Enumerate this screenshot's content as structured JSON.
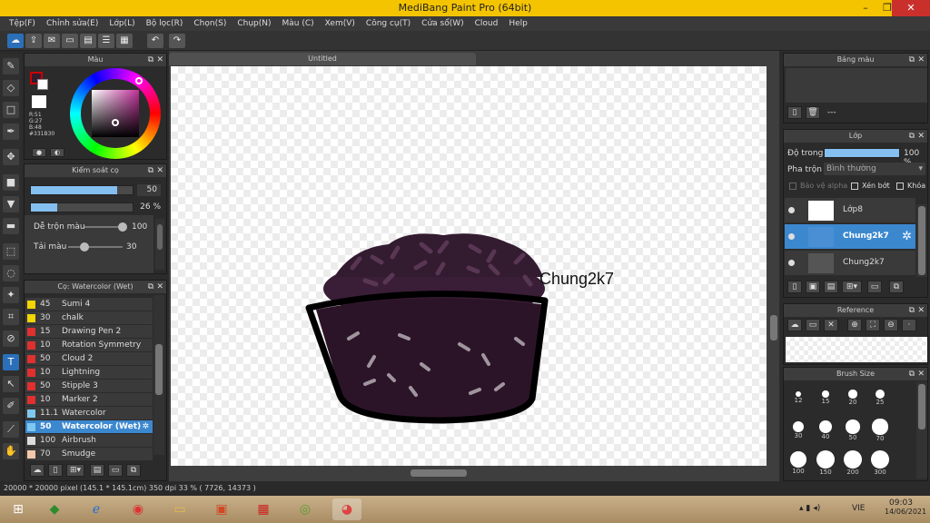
{
  "window": {
    "title": "MediBang Paint Pro (64bit)"
  },
  "menu": [
    "Tệp(F)",
    "Chỉnh sửa(E)",
    "Lớp(L)",
    "Bộ lọc(R)",
    "Chọn(S)",
    "Chụp(N)",
    "Màu (C)",
    "Xem(V)",
    "Công cụ(T)",
    "Cửa sổ(W)",
    "Cloud",
    "Help"
  ],
  "color_panel": {
    "title": "Màu",
    "r": "R:51",
    "g": "G:27",
    "b": "B:48",
    "hex": "#331B30",
    "fg_color": "#331B30",
    "ring_colors": [
      "#ff0000",
      "#ffff00",
      "#00ff00",
      "#00ffff",
      "#0000ff",
      "#ff00ff",
      "#ff0000"
    ]
  },
  "brush_control": {
    "title": "Kiểm soát cọ",
    "size_value": "50",
    "size_fill": 0.85,
    "opacity_value": "26 %",
    "opacity_fill": 0.26,
    "blend_label": "Dễ trộn màu",
    "blend_value": "100",
    "blend_fill": 1.0,
    "dye_label": "Tải màu",
    "dye_value": "30",
    "dye_fill": 0.3
  },
  "brush_list": {
    "title": "Cọ: Watercolor (Wet)",
    "items": [
      {
        "size": "45",
        "name": "Sumi 4",
        "color": "#f2d600"
      },
      {
        "size": "30",
        "name": "chalk",
        "color": "#f2d600"
      },
      {
        "size": "15",
        "name": "Drawing Pen 2",
        "color": "#e03030"
      },
      {
        "size": "10",
        "name": "Rotation Symmetry Pen",
        "color": "#e03030"
      },
      {
        "size": "50",
        "name": "Cloud 2",
        "color": "#e03030"
      },
      {
        "size": "10",
        "name": "Lightning",
        "color": "#e03030"
      },
      {
        "size": "50",
        "name": "Stipple 3",
        "color": "#e03030"
      },
      {
        "size": "10",
        "name": "Marker 2",
        "color": "#e03030"
      },
      {
        "size": "11.1",
        "name": "Watercolor",
        "color": "#7ec8f0"
      },
      {
        "size": "50",
        "name": "Watercolor (Wet)",
        "color": "#7ec8f0",
        "selected": true
      },
      {
        "size": "100",
        "name": "Airbrush",
        "color": "#dddddd"
      },
      {
        "size": "70",
        "name": "Smudge",
        "color": "#f4c8a8"
      }
    ]
  },
  "canvas": {
    "tab": "Untitled",
    "annotation": "Chung2k7"
  },
  "palette_panel": {
    "title": "Bảng màu",
    "dashes": "---"
  },
  "layer_panel": {
    "title": "Lớp",
    "opacity_label": "Độ trong",
    "opacity_value": "100 %",
    "opacity_fill": 1.0,
    "blend_label": "Pha trộn",
    "blend_value": "Bình thường",
    "protect_alpha": "Bảo vệ alpha",
    "clip": "Xén bớt",
    "lock": "Khóa",
    "layers": [
      {
        "name": "Lớp8",
        "selected": false
      },
      {
        "name": "Chung2k7",
        "selected": true
      },
      {
        "name": "Chung2k7",
        "selected": false
      }
    ]
  },
  "reference_panel": {
    "title": "Reference"
  },
  "brush_size_panel": {
    "title": "Brush Size",
    "sizes": [
      "12",
      "15",
      "20",
      "25",
      "30",
      "40",
      "50",
      "70",
      "100",
      "150",
      "200",
      "300"
    ]
  },
  "status": {
    "text": "20000 * 20000 pixel   (145.1 * 145.1cm)   350 dpi   33 %   ( 7726, 14373 )"
  },
  "taskbar": {
    "lang": "VIE",
    "time": "09:03",
    "date": "14/06/2021"
  }
}
